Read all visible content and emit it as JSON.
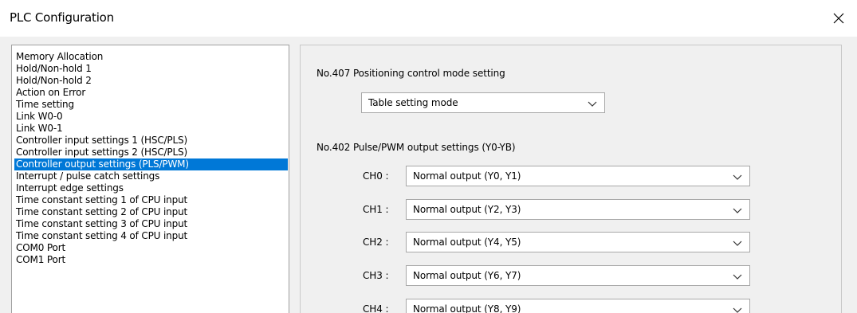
{
  "window": {
    "title": "PLC Configuration",
    "close_icon": "close-icon"
  },
  "sidebar": {
    "items": [
      {
        "label": "Memory Allocation",
        "selected": false
      },
      {
        "label": "Hold/Non-hold 1",
        "selected": false
      },
      {
        "label": "Hold/Non-hold 2",
        "selected": false
      },
      {
        "label": "Action on Error",
        "selected": false
      },
      {
        "label": "Time setting",
        "selected": false
      },
      {
        "label": "Link W0-0",
        "selected": false
      },
      {
        "label": "Link W0-1",
        "selected": false
      },
      {
        "label": "Controller input settings 1 (HSC/PLS)",
        "selected": false
      },
      {
        "label": "Controller input settings 2 (HSC/PLS)",
        "selected": false
      },
      {
        "label": "Controller output settings (PLS/PWM)",
        "selected": true
      },
      {
        "label": "Interrupt / pulse catch settings",
        "selected": false
      },
      {
        "label": "Interrupt edge settings",
        "selected": false
      },
      {
        "label": "Time constant setting 1 of CPU input",
        "selected": false
      },
      {
        "label": "Time constant setting 2 of CPU input",
        "selected": false
      },
      {
        "label": "Time constant setting 3 of CPU input",
        "selected": false
      },
      {
        "label": "Time constant setting 4 of CPU input",
        "selected": false
      },
      {
        "label": "COM0 Port",
        "selected": false
      },
      {
        "label": "COM1 Port",
        "selected": false
      }
    ]
  },
  "main": {
    "positioning": {
      "label": "No.407 Positioning control mode setting",
      "value": "Table setting mode"
    },
    "pulse_output": {
      "label": "No.402 Pulse/PWM output settings (Y0-YB)",
      "channels": [
        {
          "label": "CH0 :",
          "value": "Normal output (Y0, Y1)"
        },
        {
          "label": "CH1 :",
          "value": "Normal output (Y2, Y3)"
        },
        {
          "label": "CH2 :",
          "value": "Normal output (Y4, Y5)"
        },
        {
          "label": "CH3 :",
          "value": "Normal output (Y6, Y7)"
        },
        {
          "label": "CH4 :",
          "value": "Normal output (Y8, Y9)"
        }
      ]
    }
  },
  "colors": {
    "selection": "#0078d7",
    "selection_text": "#ffffff",
    "dialog_bg": "#f0f0f0"
  }
}
